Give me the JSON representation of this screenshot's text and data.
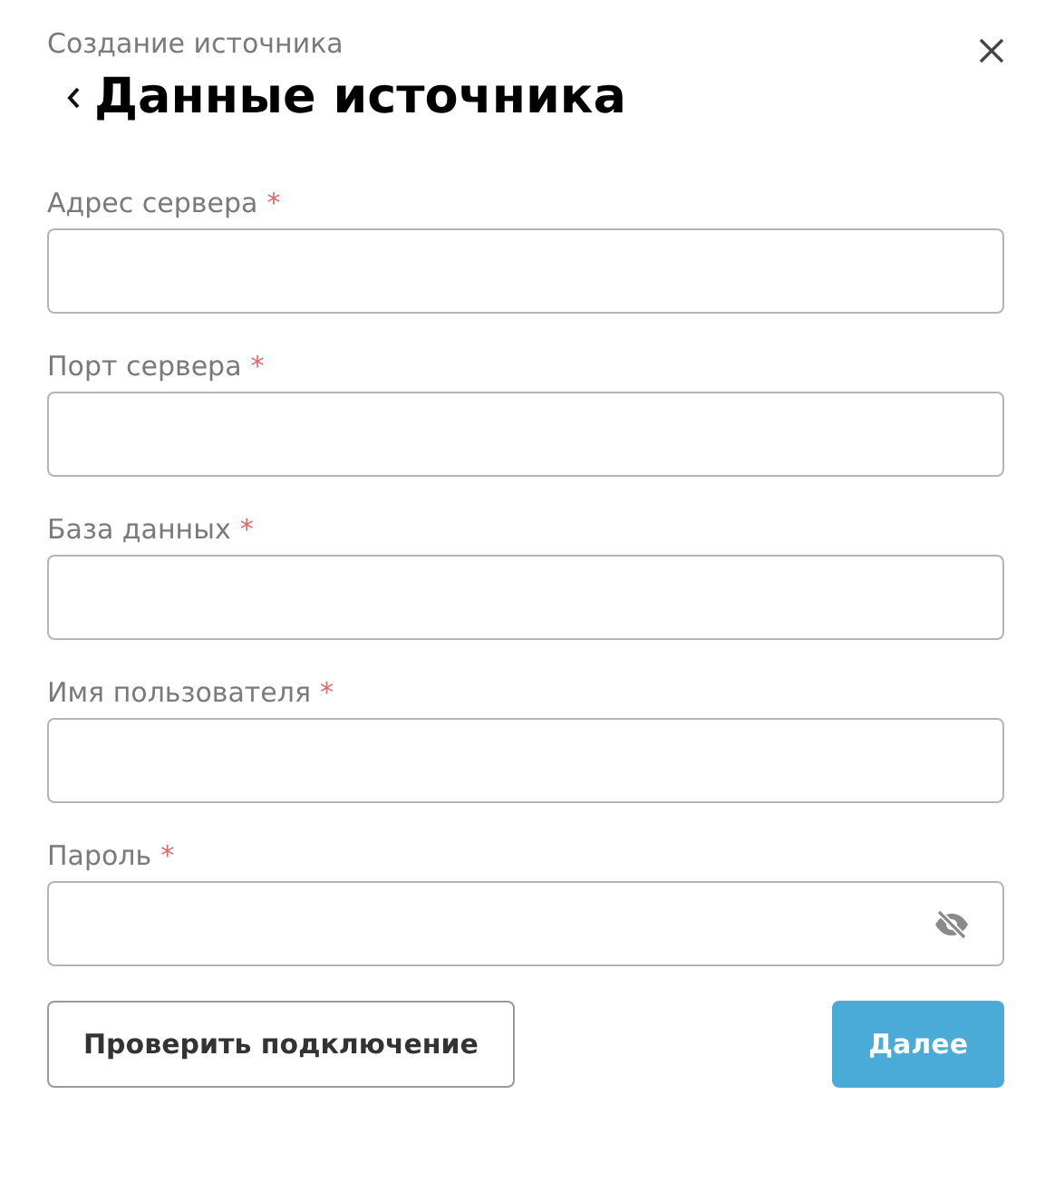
{
  "header": {
    "subtitle": "Создание источника",
    "title": "Данные источника"
  },
  "fields": [
    {
      "label": "Адрес сервера",
      "required_mark": "*",
      "kind": "text"
    },
    {
      "label": "Порт сервера",
      "required_mark": "*",
      "kind": "text"
    },
    {
      "label": "База данных",
      "required_mark": "*",
      "kind": "text"
    },
    {
      "label": "Имя пользователя",
      "required_mark": "*",
      "kind": "text"
    },
    {
      "label": "Пароль",
      "required_mark": "*",
      "kind": "password"
    }
  ],
  "buttons": [
    {
      "label": "Проверить подключение",
      "kind": "secondary"
    },
    {
      "label": "Далее",
      "kind": "primary"
    }
  ]
}
